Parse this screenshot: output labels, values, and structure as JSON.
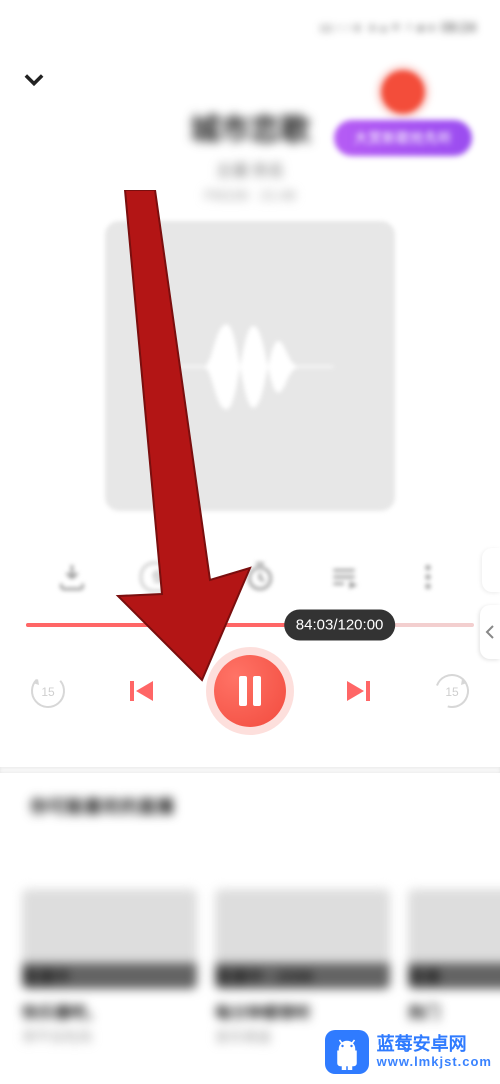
{
  "status_bar": "▭ ◦ ◦ ◐ ◑ ◒ ◓ ◔ ◕ ◐ 09:24",
  "header": {
    "collapse_aria": "collapse"
  },
  "top_right": {
    "badge_label": "大赏新歌抢先听"
  },
  "track": {
    "title": "城市恋歌",
    "artist": "主播 佚名",
    "meta": "FM106 · 21:48"
  },
  "actions": {
    "download_aria": "download",
    "speed_label": "倍速",
    "timer_aria": "timer",
    "playlist_aria": "playlist",
    "more_aria": "more"
  },
  "progress": {
    "current": "84:03",
    "total": "120:00",
    "percent": 70,
    "tooltip": "84:03/120:00"
  },
  "controls": {
    "back15": "15",
    "fwd15": "15",
    "prev_aria": "previous-track",
    "next_aria": "next-track",
    "pause_aria": "pause"
  },
  "section_heading": "你可能喜欢的直播",
  "recs": [
    {
      "tag": "直播中",
      "title": "快乐播吧，",
      "sub": "停不住吃肉"
    },
    {
      "tag": "直播中 · 2098",
      "title": "每分钟都想听",
      "sub": "音乐频道"
    },
    {
      "tag": "直播",
      "title": "热门",
      "sub": ""
    }
  ],
  "watermark": {
    "line1": "蓝莓安卓网",
    "line2": "www.lmkjst.com"
  },
  "colors": {
    "accent": "#f24b3e",
    "pill": "#9a4cf0",
    "wm": "#2f7bff"
  }
}
